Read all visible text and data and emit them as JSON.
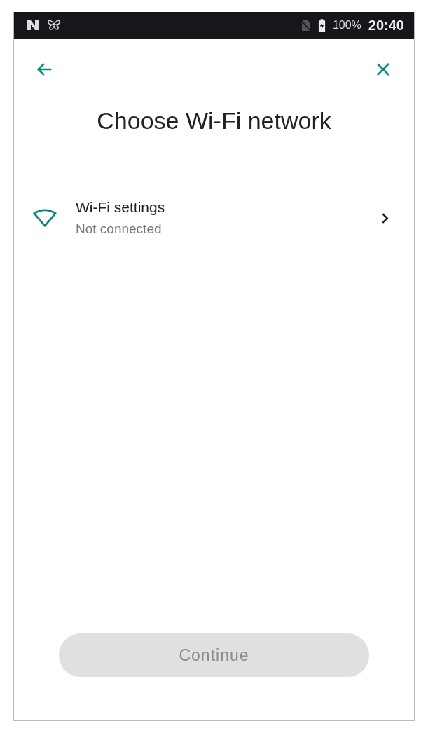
{
  "status_bar": {
    "battery": "100%",
    "time": "20:40"
  },
  "title": "Choose Wi-Fi network",
  "wifi_item": {
    "title": "Wi-Fi settings",
    "subtitle": "Not connected"
  },
  "continue_button": {
    "label": "Continue",
    "disabled": true
  }
}
